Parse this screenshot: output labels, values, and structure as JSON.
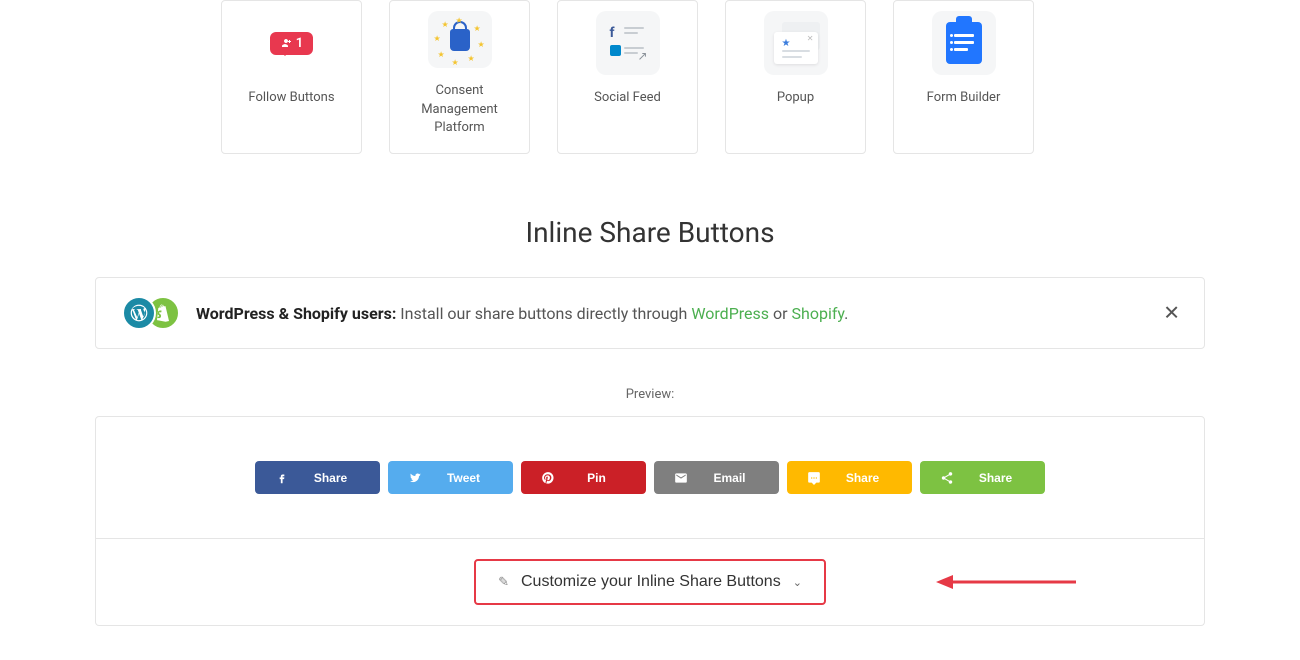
{
  "cards": [
    {
      "label": "Follow Buttons",
      "badge_count": "1"
    },
    {
      "label": "Consent Management Platform"
    },
    {
      "label": "Social Feed"
    },
    {
      "label": "Popup"
    },
    {
      "label": "Form Builder"
    }
  ],
  "section": {
    "title": "Inline Share Buttons"
  },
  "banner": {
    "strong": "WordPress & Shopify users:",
    "middle": " Install our share buttons directly through ",
    "wp_link": "WordPress",
    "or": " or ",
    "sh_link": "Shopify",
    "end": "."
  },
  "preview": {
    "label": "Preview:",
    "buttons": [
      {
        "label": "Share",
        "class": "sb-fb"
      },
      {
        "label": "Tweet",
        "class": "sb-tw"
      },
      {
        "label": "Pin",
        "class": "sb-pn"
      },
      {
        "label": "Email",
        "class": "sb-em"
      },
      {
        "label": "Share",
        "class": "sb-sms"
      },
      {
        "label": "Share",
        "class": "sb-st"
      }
    ]
  },
  "customize": {
    "label": "Customize your Inline Share Buttons"
  }
}
